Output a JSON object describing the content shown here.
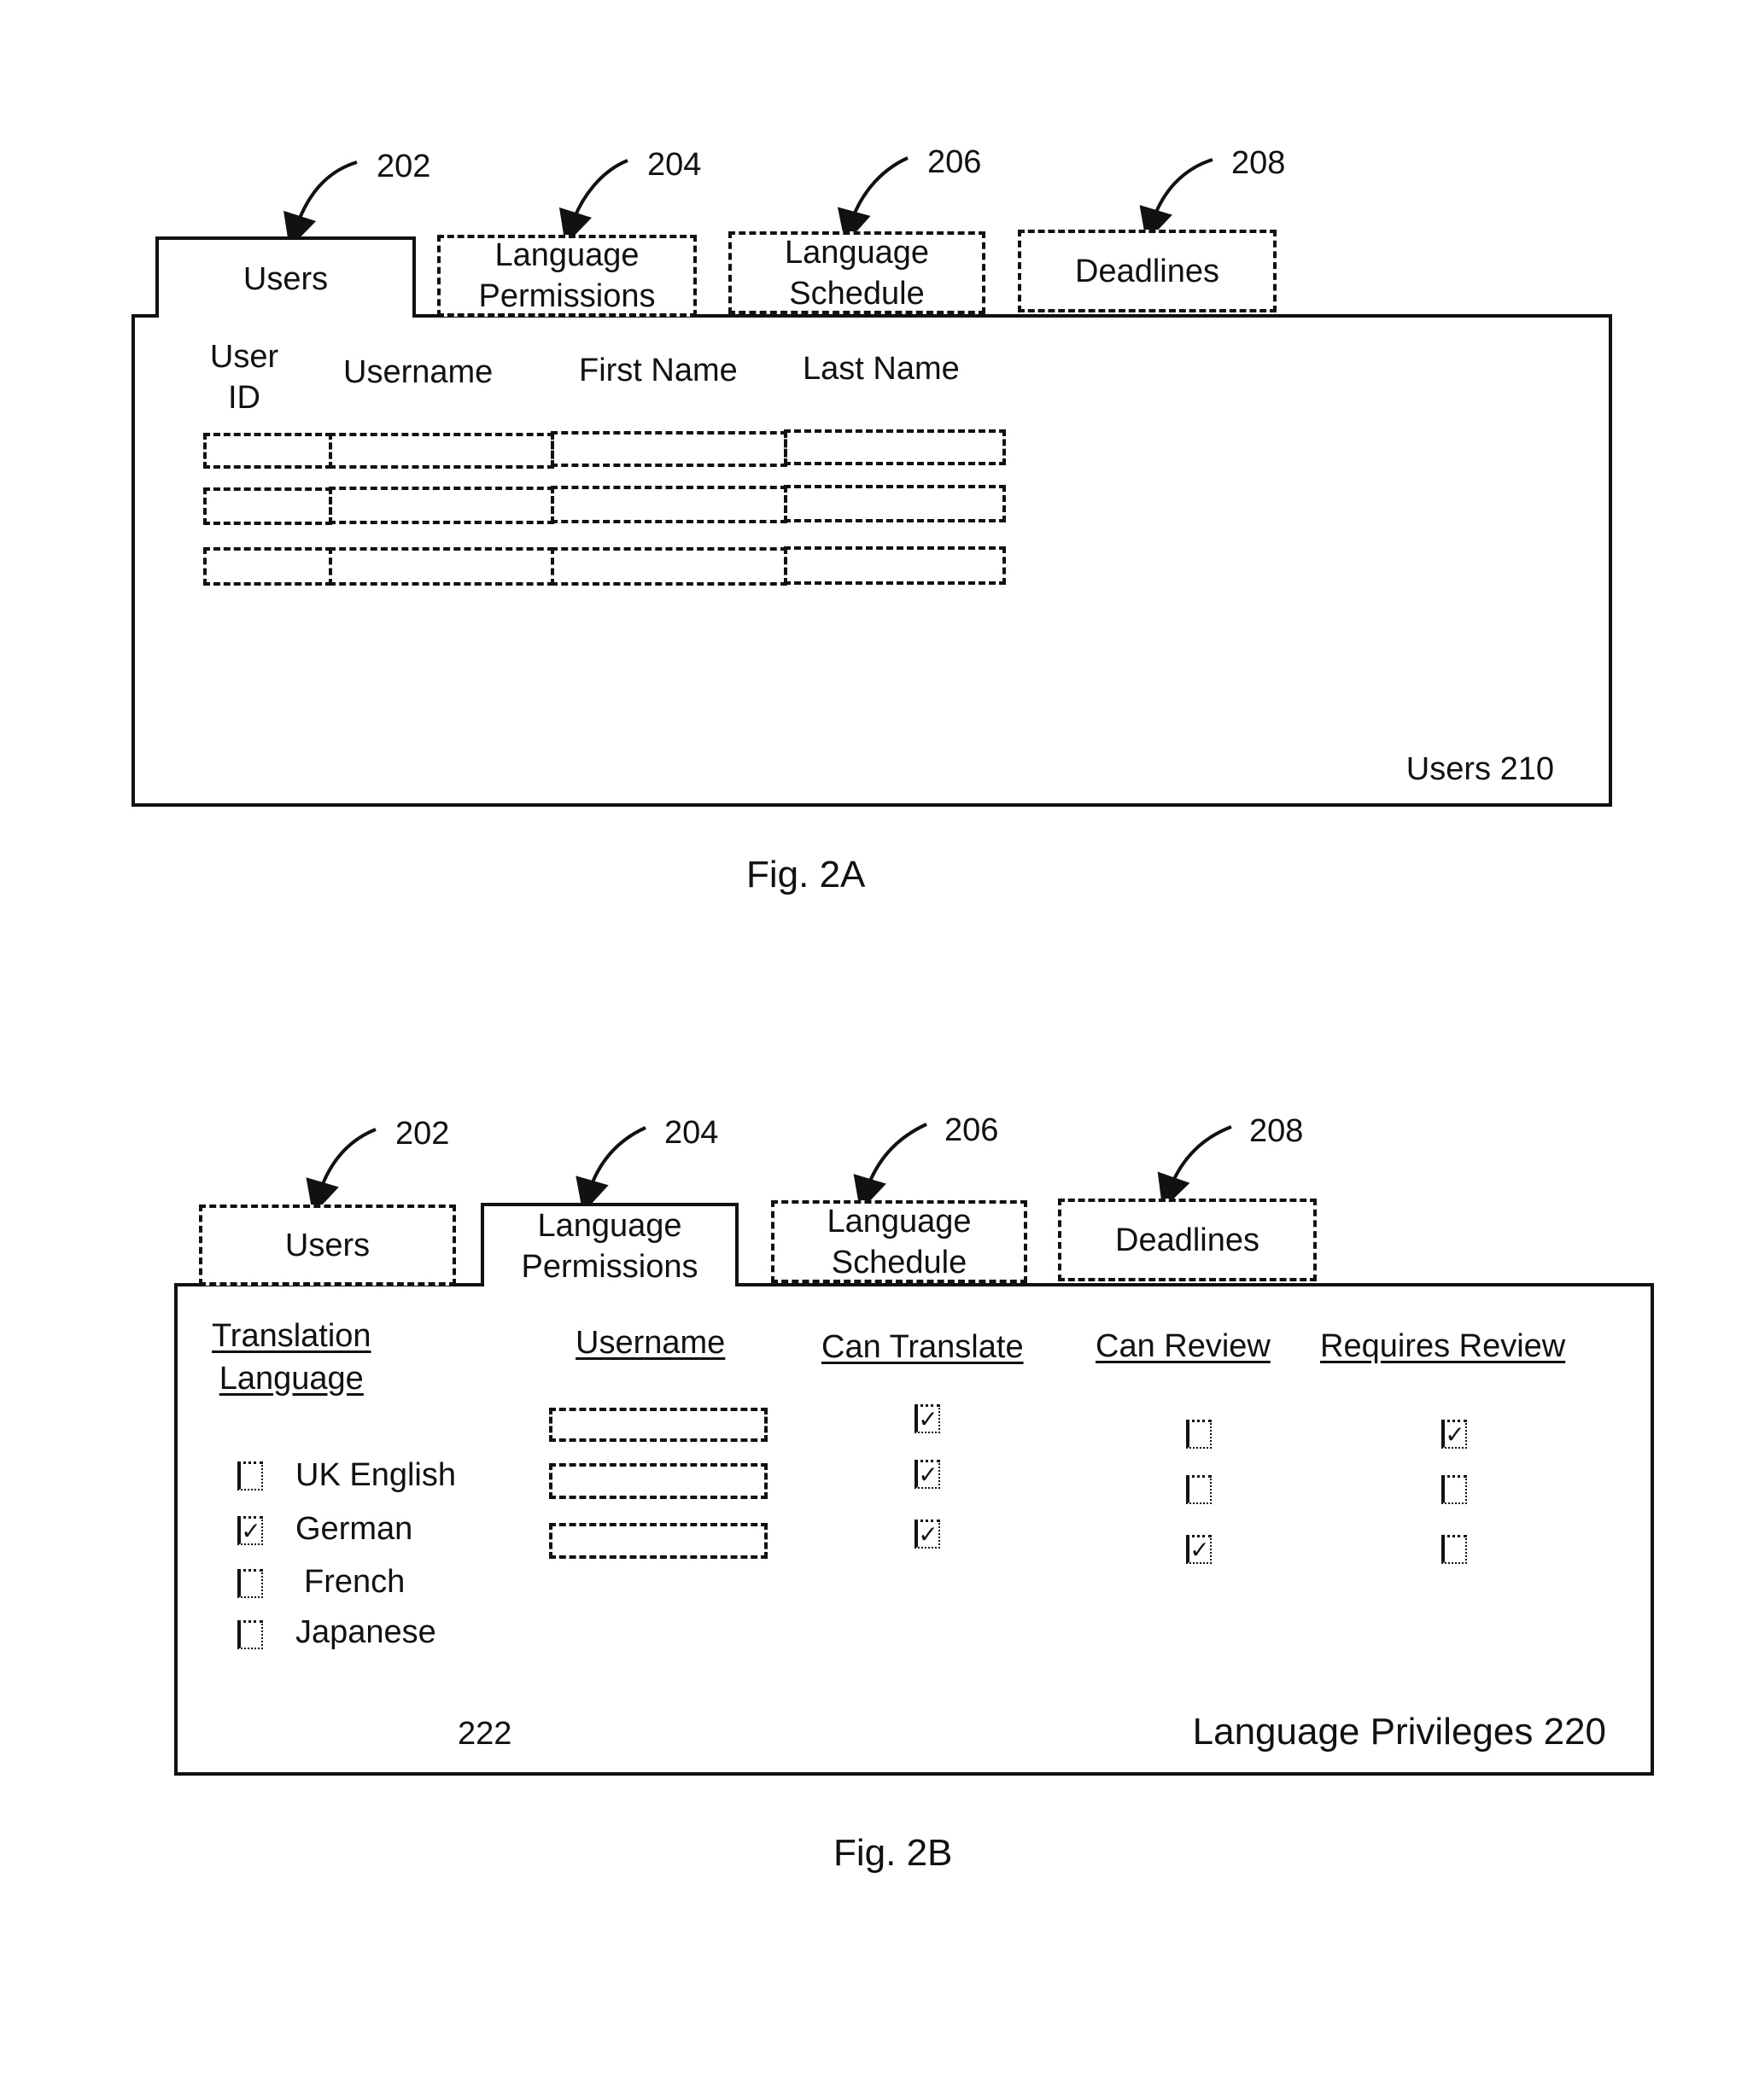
{
  "fig_a": {
    "caption": "Fig. 2A",
    "tabs": [
      {
        "label": "Users",
        "ref": "202",
        "active": true
      },
      {
        "label": "Language Permissions",
        "ref": "204",
        "active": false
      },
      {
        "label": "Language Schedule",
        "ref": "206",
        "active": false
      },
      {
        "label": "Deadlines",
        "ref": "208",
        "active": false
      }
    ],
    "tab_lines": {
      "t0": [
        "Users"
      ],
      "t1": [
        "Language",
        "Permissions"
      ],
      "t2": [
        "Language",
        "Schedule"
      ],
      "t3": [
        "Deadlines"
      ]
    },
    "panel_label": "Users 210",
    "columns": {
      "user_id_1": "User",
      "user_id_2": "ID",
      "username": "Username",
      "first_name": "First Name",
      "last_name": "Last Name"
    },
    "rows": [
      {
        "user_id": "",
        "username": "",
        "first_name": "",
        "last_name": ""
      },
      {
        "user_id": "",
        "username": "",
        "first_name": "",
        "last_name": ""
      },
      {
        "user_id": "",
        "username": "",
        "first_name": "",
        "last_name": ""
      }
    ]
  },
  "fig_b": {
    "caption": "Fig. 2B",
    "tabs": [
      {
        "label": "Users",
        "ref": "202",
        "active": false
      },
      {
        "label": "Language Permissions",
        "ref": "204",
        "active": true
      },
      {
        "label": "Language Schedule",
        "ref": "206",
        "active": false
      },
      {
        "label": "Deadlines",
        "ref": "208",
        "active": false
      }
    ],
    "tab_lines": {
      "t0": [
        "Users"
      ],
      "t1": [
        "Language",
        "Permissions"
      ],
      "t2": [
        "Language",
        "Schedule"
      ],
      "t3": [
        "Deadlines"
      ]
    },
    "panel_label": "Language Privileges 220",
    "language_list_ref": "222",
    "columns": {
      "translation_language_1": "Translation",
      "translation_language_2": "Language",
      "username": "Username",
      "can_translate": "Can Translate",
      "can_review": "Can Review",
      "requires_review": "Requires Review"
    },
    "languages": [
      {
        "name": "UK English",
        "checked": false
      },
      {
        "name": "German",
        "checked": true
      },
      {
        "name": "French",
        "checked": false
      },
      {
        "name": "Japanese",
        "checked": false
      }
    ],
    "rows": [
      {
        "username": "",
        "can_translate": true,
        "can_review": false,
        "requires_review": true
      },
      {
        "username": "",
        "can_translate": true,
        "can_review": false,
        "requires_review": false
      },
      {
        "username": "",
        "can_translate": true,
        "can_review": true,
        "requires_review": false
      }
    ],
    "check_glyph": "✓"
  }
}
